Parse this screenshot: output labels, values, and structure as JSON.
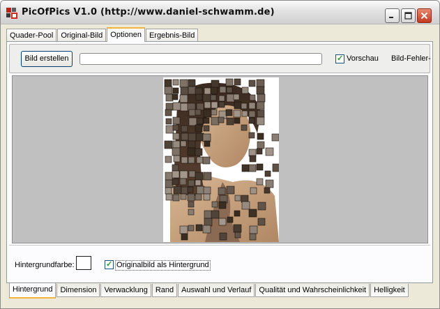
{
  "window": {
    "title": "PicOfPics V1.0 (http://www.daniel-schwamm.de)",
    "icon": "app-icon",
    "controls": [
      "minimize-icon",
      "maximize-icon",
      "close-icon"
    ]
  },
  "tabs_top": [
    {
      "label": "Quader-Pool",
      "active": false
    },
    {
      "label": "Original-Bild",
      "active": false
    },
    {
      "label": "Optionen",
      "active": true
    },
    {
      "label": "Ergebnis-Bild",
      "active": false
    }
  ],
  "toolbar": {
    "create_label": "Bild erstellen",
    "progress_value": 0,
    "preview_label": "Vorschau",
    "preview_checked": true,
    "error_label": "Bild-Fehler-S"
  },
  "options": {
    "bg_color_label": "Hintergrundfarbe:",
    "bg_color": "#ffffff",
    "original_bg_label": "Originalbild als Hintergrund",
    "original_bg_checked": true
  },
  "tabs_bottom": [
    {
      "label": "Hintergrund",
      "active": true
    },
    {
      "label": "Dimension",
      "active": false
    },
    {
      "label": "Verwacklung",
      "active": false
    },
    {
      "label": "Rand",
      "active": false
    },
    {
      "label": "Auswahl und Verlauf",
      "active": false
    },
    {
      "label": "Qualität und Wahrscheinlichkeit",
      "active": false
    },
    {
      "label": "Helligkeit",
      "active": false
    }
  ],
  "colors": {
    "accent": "#f3b33d",
    "progress": "#3aa04a",
    "check": "#21a121",
    "preview_bg": "#c0c0c0"
  }
}
